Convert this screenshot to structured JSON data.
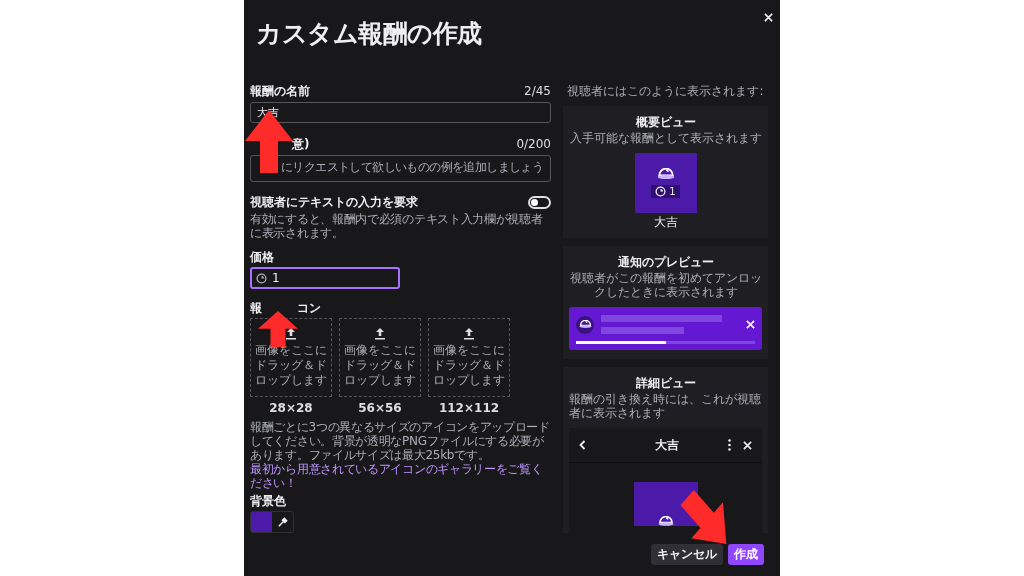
{
  "dialog": {
    "title": "カスタム報酬の作成"
  },
  "name_field": {
    "label": "報酬の名前",
    "counter": "2/45",
    "value": "大吉"
  },
  "description_field": {
    "label": "意)",
    "counter": "0/200",
    "placeholder": "にリクエストして欲しいものの例を追加しましょう"
  },
  "require_text": {
    "label": "視聴者にテキストの入力を要求",
    "help": "有効にすると、報酬内で必須のテキスト入力欄が視聴者に表示されます。",
    "on": false
  },
  "price_field": {
    "label": "価格",
    "value": "1",
    "focused": true
  },
  "icon_section": {
    "label_parts": [
      "報",
      "コン"
    ],
    "uploads": [
      {
        "text": "画像をここにドラッグ＆ドロップします",
        "size": "28×28"
      },
      {
        "text": "画像をここにドラッグ＆ドロップします",
        "size": "56×56"
      },
      {
        "text": "画像をここにドラッグ＆ドロップします",
        "size": "112×112"
      }
    ],
    "help": "報酬ごとに3つの異なるサイズのアイコンをアップロードしてください。背景が透明なPNGファイルにする必要があります。ファイルサイズは最大25kbです。",
    "link": "最初から用意されているアイコンのギャラリーをご覧ください！"
  },
  "background_color": {
    "label": "背景色",
    "color": "#4b1aa8"
  },
  "preview": {
    "heading": "視聴者にはこのように表示されます:",
    "summary": {
      "title": "概要ビュー",
      "subtitle": "入手可能な報酬として表示されます",
      "cost": "1",
      "name": "大吉"
    },
    "notification": {
      "title": "通知のプレビュー",
      "subtitle": "視聴者がこの報酬を初めてアンロックしたときに表示されます",
      "level": 0.5
    },
    "detail": {
      "title": "詳細ビュー",
      "subtitle": "報酬の引き換え時には、これが視聴者に表示されます",
      "name": "大吉"
    }
  },
  "buttons": [
    {
      "label": "キャンセル",
      "kind": "secondary"
    },
    {
      "label": "作成",
      "kind": "primary"
    }
  ],
  "annotation_arrows": [
    {
      "kind": "arrow-up"
    },
    {
      "kind": "arrow-up"
    },
    {
      "kind": "arrow-down-right"
    }
  ]
}
